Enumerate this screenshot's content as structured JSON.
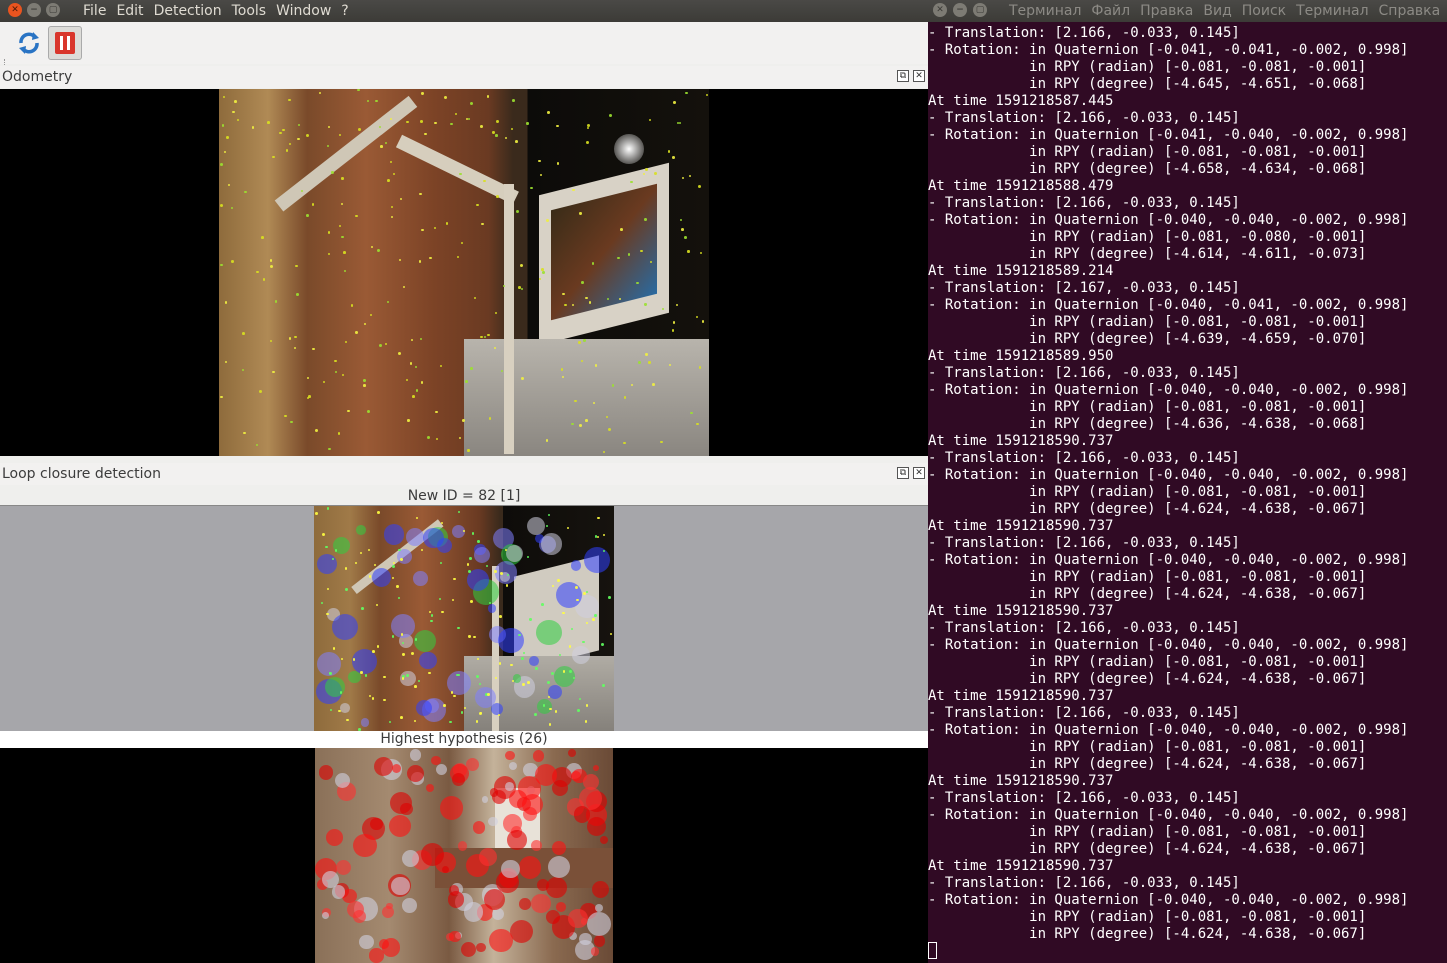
{
  "app": {
    "menu": [
      "File",
      "Edit",
      "Detection",
      "Tools",
      "Window",
      "?"
    ],
    "toolbar": {
      "refresh_icon": "refresh-icon",
      "pause_icon": "pause-icon"
    },
    "odometry": {
      "title": "Odometry"
    },
    "loop": {
      "title": "Loop closure detection",
      "new_id_caption": "New ID = 82 [1]",
      "hypothesis_caption": "Highest hypothesis (26)"
    }
  },
  "terminal": {
    "menu": [
      "Терминал",
      "Файл",
      "Правка",
      "Вид",
      "Поиск",
      "Терминал",
      "Справка"
    ],
    "lines": [
      "- Translation: [2.166, -0.033, 0.145]",
      "- Rotation: in Quaternion [-0.041, -0.041, -0.002, 0.998]",
      "            in RPY (radian) [-0.081, -0.081, -0.001]",
      "            in RPY (degree) [-4.645, -4.651, -0.068]",
      "At time 1591218587.445",
      "- Translation: [2.166, -0.033, 0.145]",
      "- Rotation: in Quaternion [-0.041, -0.040, -0.002, 0.998]",
      "            in RPY (radian) [-0.081, -0.081, -0.001]",
      "            in RPY (degree) [-4.658, -4.634, -0.068]",
      "At time 1591218588.479",
      "- Translation: [2.166, -0.033, 0.145]",
      "- Rotation: in Quaternion [-0.040, -0.040, -0.002, 0.998]",
      "            in RPY (radian) [-0.081, -0.080, -0.001]",
      "            in RPY (degree) [-4.614, -4.611, -0.073]",
      "At time 1591218589.214",
      "- Translation: [2.167, -0.033, 0.145]",
      "- Rotation: in Quaternion [-0.040, -0.041, -0.002, 0.998]",
      "            in RPY (radian) [-0.081, -0.081, -0.001]",
      "            in RPY (degree) [-4.639, -4.659, -0.070]",
      "At time 1591218589.950",
      "- Translation: [2.166, -0.033, 0.145]",
      "- Rotation: in Quaternion [-0.040, -0.040, -0.002, 0.998]",
      "            in RPY (radian) [-0.081, -0.081, -0.001]",
      "            in RPY (degree) [-4.636, -4.638, -0.068]",
      "At time 1591218590.737",
      "- Translation: [2.166, -0.033, 0.145]",
      "- Rotation: in Quaternion [-0.040, -0.040, -0.002, 0.998]",
      "            in RPY (radian) [-0.081, -0.081, -0.001]",
      "            in RPY (degree) [-4.624, -4.638, -0.067]",
      "At time 1591218590.737",
      "- Translation: [2.166, -0.033, 0.145]",
      "- Rotation: in Quaternion [-0.040, -0.040, -0.002, 0.998]",
      "            in RPY (radian) [-0.081, -0.081, -0.001]",
      "            in RPY (degree) [-4.624, -4.638, -0.067]",
      "At time 1591218590.737",
      "- Translation: [2.166, -0.033, 0.145]",
      "- Rotation: in Quaternion [-0.040, -0.040, -0.002, 0.998]",
      "            in RPY (radian) [-0.081, -0.081, -0.001]",
      "            in RPY (degree) [-4.624, -4.638, -0.067]",
      "At time 1591218590.737",
      "- Translation: [2.166, -0.033, 0.145]",
      "- Rotation: in Quaternion [-0.040, -0.040, -0.002, 0.998]",
      "            in RPY (radian) [-0.081, -0.081, -0.001]",
      "            in RPY (degree) [-4.624, -4.638, -0.067]",
      "At time 1591218590.737",
      "- Translation: [2.166, -0.033, 0.145]",
      "- Rotation: in Quaternion [-0.040, -0.040, -0.002, 0.998]",
      "            in RPY (radian) [-0.081, -0.081, -0.001]",
      "            in RPY (degree) [-4.624, -4.638, -0.067]",
      "At time 1591218590.737",
      "- Translation: [2.166, -0.033, 0.145]",
      "- Rotation: in Quaternion [-0.040, -0.040, -0.002, 0.998]",
      "            in RPY (radian) [-0.081, -0.081, -0.001]",
      "            in RPY (degree) [-4.624, -4.638, -0.067]"
    ]
  },
  "colors": {
    "terminal_bg": "#300a24",
    "close": "#e9541f",
    "pause": "#d9362b"
  }
}
